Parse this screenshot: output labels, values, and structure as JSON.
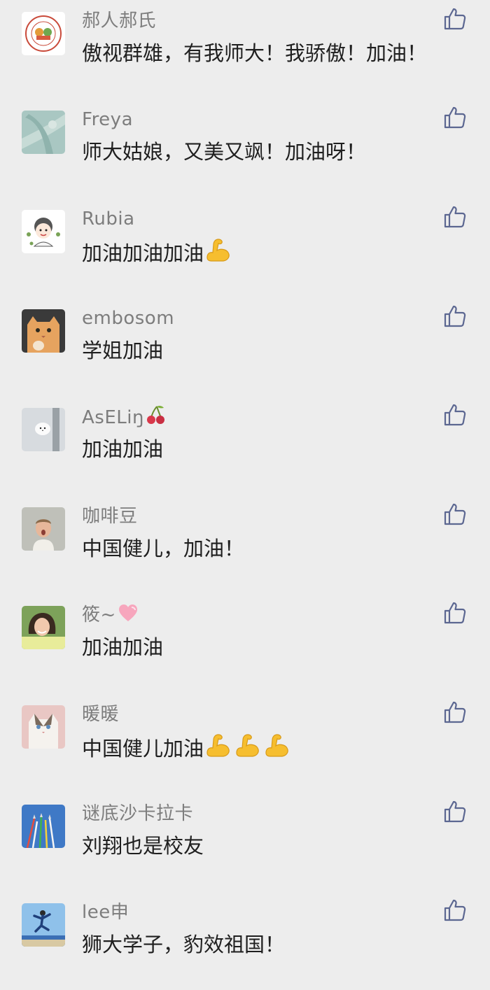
{
  "comments": [
    {
      "nickname": "郝人郝氏",
      "text": "傲视群雄，有我师大！我骄傲！加油！",
      "avatar": "university-seal-avatar",
      "text_emoji": []
    },
    {
      "nickname": "Freya",
      "text": "师大姑娘，又美又飒！加油呀！",
      "avatar": "leaf-texture-avatar",
      "text_emoji": []
    },
    {
      "nickname": "Rubia",
      "text": "加油加油加油",
      "avatar": "cartoon-girl-avatar",
      "text_emoji": [
        "flexed-biceps"
      ]
    },
    {
      "nickname": "embosom",
      "text": "学姐加油",
      "avatar": "orange-cat-avatar",
      "text_emoji": []
    },
    {
      "nickname": "AsELiŋ",
      "text": "加油加油",
      "avatar": "white-bird-avatar",
      "name_emoji": "cherries",
      "text_emoji": []
    },
    {
      "nickname": "咖啡豆",
      "text": "中国健儿，加油！",
      "avatar": "child-photo-avatar",
      "text_emoji": []
    },
    {
      "nickname": "筱~",
      "text": "加油加油",
      "avatar": "woman-photo-avatar",
      "name_emoji": "pink-heart",
      "text_emoji": []
    },
    {
      "nickname": "暖暖",
      "text": "中国健儿加油",
      "avatar": "ragdoll-cat-avatar",
      "text_emoji": [
        "flexed-biceps",
        "flexed-biceps",
        "flexed-biceps"
      ]
    },
    {
      "nickname": "谜底沙卡拉卡",
      "text": "刘翔也是校友",
      "avatar": "jets-sky-avatar",
      "text_emoji": []
    },
    {
      "nickname": "lee申",
      "text": "狮大学子，豹效祖国！",
      "avatar": "jumping-person-avatar",
      "text_emoji": []
    }
  ],
  "like_icon": "thumbs-up-outline-icon",
  "colors": {
    "background": "#ededed",
    "nickname": "#7d7d7d",
    "text": "#1f1f1f",
    "like_icon": "#5c6791"
  }
}
